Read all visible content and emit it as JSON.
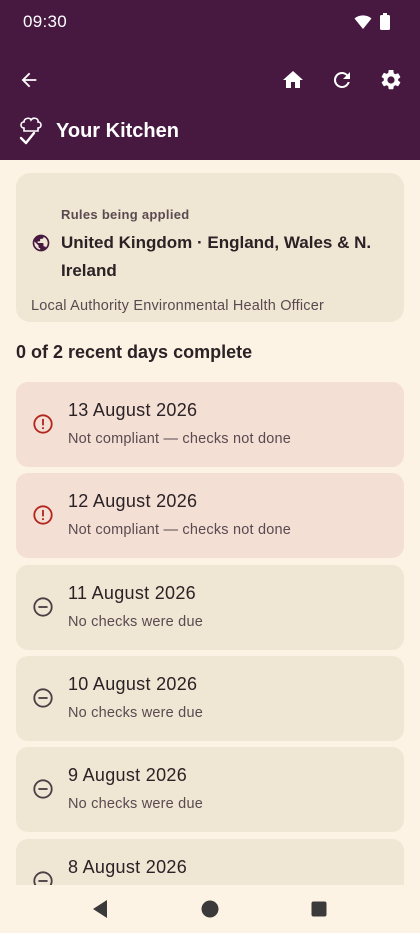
{
  "status_bar": {
    "time": "09:30",
    "wifi_icon": "wifi-icon",
    "battery_icon": "battery-icon"
  },
  "app_bar": {
    "back_icon": "arrow-back-icon",
    "home_icon": "home-icon",
    "refresh_icon": "refresh-icon",
    "settings_icon": "gear-icon",
    "logo_icon": "chef-hat-check-icon",
    "title": "Your Kitchen"
  },
  "rules": {
    "caption": "Rules being applied",
    "icon": "globe-icon",
    "country": "United Kingdom · England, Wales & N. Ireland",
    "officer": "Local Authority Environmental Health Officer"
  },
  "summary": "0 of 2 recent days complete",
  "days": [
    {
      "date": "13 August 2026",
      "note": "Not compliant — checks not done",
      "status": "not-compliant",
      "icon": "alert-circle-icon"
    },
    {
      "date": "12 August 2026",
      "note": "Not compliant — checks not done",
      "status": "not-compliant",
      "icon": "alert-circle-icon"
    },
    {
      "date": "11 August 2026",
      "note": "No checks were due",
      "status": "none-due",
      "icon": "minus-circle-icon"
    },
    {
      "date": "10 August 2026",
      "note": "No checks were due",
      "status": "none-due",
      "icon": "minus-circle-icon"
    },
    {
      "date": "9 August 2026",
      "note": "No checks were due",
      "status": "none-due",
      "icon": "minus-circle-icon"
    },
    {
      "date": "8 August 2026",
      "note": "",
      "status": "none-due",
      "icon": "minus-circle-icon"
    }
  ],
  "colors": {
    "app_bar": "#471941",
    "background": "#fdf3e4",
    "card": "#f0e6d4",
    "card_alert": "#f3dfd4",
    "alert_icon": "#b3261e"
  },
  "system_nav": {
    "back": "nav-back-icon",
    "home": "nav-home-icon",
    "recents": "nav-recents-icon"
  }
}
